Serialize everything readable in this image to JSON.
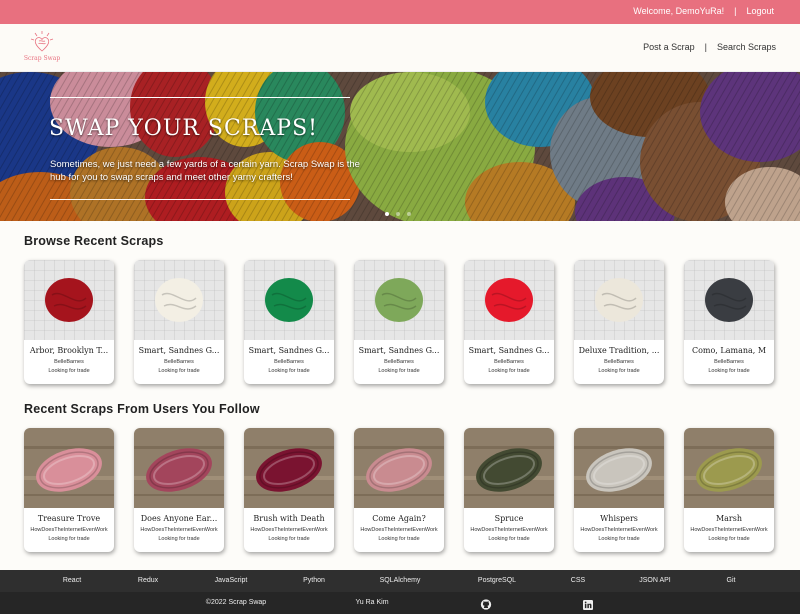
{
  "topbar": {
    "welcome": "Welcome, DemoYuRa!",
    "separator": "|",
    "logout": "Logout"
  },
  "nav": {
    "logo_text": "Scrap Swap",
    "post_scrap": "Post a Scrap",
    "separator": "|",
    "search_scraps": "Search Scraps"
  },
  "hero": {
    "title": "SWAP YOUR SCRAPS!",
    "text": "Sometimes, we just need a few yards of a certain yarn. Scrap Swap is the hub for you to swap scraps and meet other yarny crafters!",
    "slide_count": 3,
    "active_slide": 1
  },
  "sections": {
    "recent": "Browse Recent Scraps",
    "following": "Recent Scraps From Users You Follow"
  },
  "recent_scraps": [
    {
      "title": "Arbor, Brooklyn T...",
      "user": "BelleBarnes",
      "status": "Looking for trade",
      "color": "#a5141d"
    },
    {
      "title": "Smart, Sandnes G...",
      "user": "BelleBarnes",
      "status": "Looking for trade",
      "color": "#f3efe4"
    },
    {
      "title": "Smart, Sandnes G...",
      "user": "BelleBarnes",
      "status": "Looking for trade",
      "color": "#138a4a"
    },
    {
      "title": "Smart, Sandnes G...",
      "user": "BelleBarnes",
      "status": "Looking for trade",
      "color": "#7ea85a"
    },
    {
      "title": "Smart, Sandnes G...",
      "user": "BelleBarnes",
      "status": "Looking for trade",
      "color": "#e5192b"
    },
    {
      "title": "Deluxe Tradition, ...",
      "user": "BelleBarnes",
      "status": "Looking for trade",
      "color": "#ece7db"
    },
    {
      "title": "Como, Lamana, M",
      "user": "BelleBarnes",
      "status": "Looking for trade",
      "color": "#3a3d42"
    }
  ],
  "follow_scraps": [
    {
      "title": "Treasure Trove",
      "user": "HowDoesTheInternetEvenWork",
      "status": "Looking for trade",
      "color": "#d98f9a"
    },
    {
      "title": "Does Anyone Ear...",
      "user": "HowDoesTheInternetEvenWork",
      "status": "Looking for trade",
      "color": "#a3455c"
    },
    {
      "title": "Brush with Death",
      "user": "HowDoesTheInternetEvenWork",
      "status": "Looking for trade",
      "color": "#7a1330"
    },
    {
      "title": "Come Again?",
      "user": "HowDoesTheInternetEvenWork",
      "status": "Looking for trade",
      "color": "#c98b90"
    },
    {
      "title": "Spruce",
      "user": "HowDoesTheInternetEvenWork",
      "status": "Looking for trade",
      "color": "#434a32"
    },
    {
      "title": "Whispers",
      "user": "HowDoesTheInternetEvenWork",
      "status": "Looking for trade",
      "color": "#c9c5bd"
    },
    {
      "title": "Marsh",
      "user": "HowDoesTheInternetEvenWork",
      "status": "Looking for trade",
      "color": "#9c9a4e"
    }
  ],
  "footer": {
    "tech": [
      "React",
      "Redux",
      "JavaScript",
      "Python",
      "SQLAlchemy",
      "PostgreSQL",
      "CSS",
      "JSON API",
      "Git"
    ],
    "copyright": "©2022 Scrap Swap",
    "author": "Yu Ra Kim",
    "github_icon": "github-icon",
    "linkedin_icon": "linkedin-icon"
  },
  "colors": {
    "accent": "#e8707f",
    "footer": "#2f2f2f"
  }
}
